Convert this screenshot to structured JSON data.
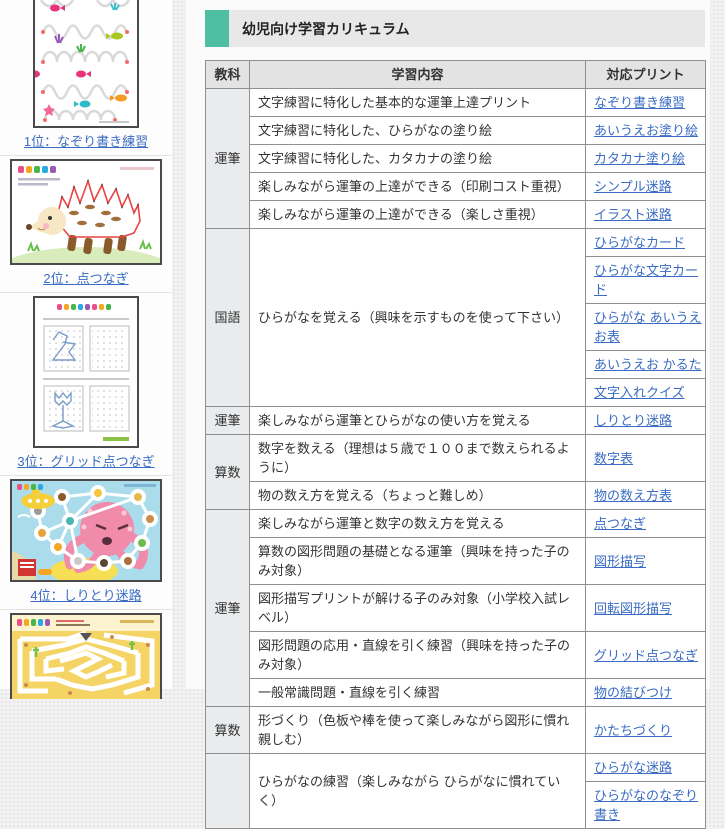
{
  "colors": {
    "accent": "#4fbfa3",
    "link": "#3a6cc3",
    "table_border": "#8f8f8f",
    "subject_cell_bg": "#e9ebed",
    "header_row_bg": "#e3e3e4"
  },
  "sidebar": {
    "items": [
      {
        "caption": "1位：なぞり書き練習",
        "image": "tracing-practice-worksheet"
      },
      {
        "caption": "2位：点つなぎ",
        "image": "hedgehog-dot-to-dot-worksheet"
      },
      {
        "caption": "3位：グリッド点つなぎ",
        "image": "grid-dot-to-dot-worksheet"
      },
      {
        "caption": "4位：しりとり迷路",
        "image": "shiritori-maze-worksheet"
      },
      {
        "caption": "",
        "image": "adventure-maze-worksheet"
      }
    ]
  },
  "main": {
    "title": "幼児向け学習カリキュラム",
    "table": {
      "header": {
        "subject": "教科",
        "content": "学習内容",
        "print": "対応プリント"
      },
      "rows": [
        {
          "subject": "運筆",
          "content": "文字練習に特化した基本的な運筆上達プリント",
          "link": "なぞり書き練習"
        },
        {
          "content": "文字練習に特化した、ひらがなの塗り絵",
          "link": "あいうえお塗り絵"
        },
        {
          "content": "文字練習に特化した、カタカナの塗り絵",
          "link": "カタカナ塗り絵"
        },
        {
          "content": "楽しみながら運筆の上達ができる（印刷コスト重視）",
          "link": "シンプル迷路"
        },
        {
          "content": "楽しみながら運筆の上達ができる（楽しさ重視）",
          "link": "イラスト迷路"
        },
        {
          "subject": "国語",
          "content": "ひらがなを覚える（興味を示すものを使って下さい）",
          "link": "ひらがなカード"
        },
        {
          "link": "ひらがな文字カード"
        },
        {
          "link": "ひらがな あいうえお表"
        },
        {
          "link": "あいうえお かるた"
        },
        {
          "link": "文字入れクイズ"
        },
        {
          "subject": "運筆",
          "content": "楽しみながら運筆とひらがなの使い方を覚える",
          "link": "しりとり迷路"
        },
        {
          "subject": "算数",
          "content": "数字を数える（理想は５歳で１００まで数えられるように）",
          "link": "数字表"
        },
        {
          "content": "物の数え方を覚える（ちょっと難しめ）",
          "link": "物の数え方表"
        },
        {
          "subject": "運筆",
          "content": "楽しみながら運筆と数字の数え方を覚える",
          "link": "点つなぎ"
        },
        {
          "content": "算数の図形問題の基礎となる運筆（興味を持った子のみ対象）",
          "link": "図形描写"
        },
        {
          "content": "図形描写プリントが解ける子のみ対象（小学校入試レベル）",
          "link": "回転図形描写"
        },
        {
          "content": "図形問題の応用・直線を引く練習（興味を持った子のみ対象）",
          "link": "グリッド点つなぎ"
        },
        {
          "content": "一般常識問題・直線を引く練習",
          "link": "物の結びつけ"
        },
        {
          "subject": "算数",
          "content": "形づくり（色板や棒を使って楽しみながら図形に慣れ親しむ）",
          "link": "かたちづくり"
        },
        {
          "subject": "",
          "content": "ひらがなの練習（楽しみながら ひらがなに慣れていく）",
          "link": "ひらがな迷路"
        },
        {
          "link": "ひらがなのなぞり書き"
        }
      ]
    }
  }
}
